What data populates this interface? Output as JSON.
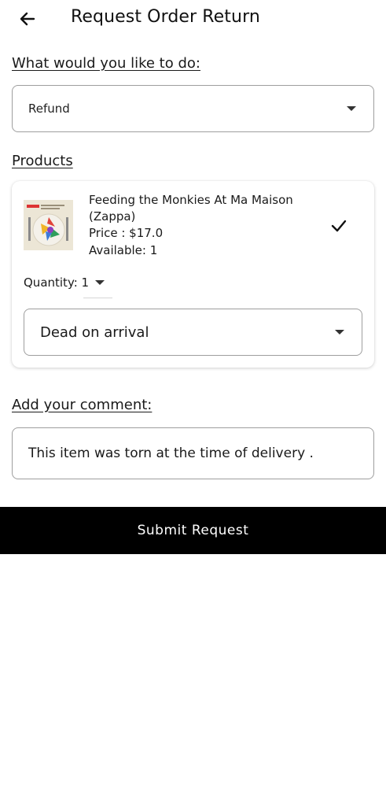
{
  "header": {
    "back_icon": "arrow-left-icon",
    "title": "Request Order Return"
  },
  "action": {
    "label": "What would you like to do:",
    "selected": "Refund"
  },
  "products": {
    "label": "Products",
    "items": [
      {
        "name": "Feeding the Monkies At Ma Maison (Zappa)",
        "price": "Price : $17.0",
        "available": "Available: 1",
        "selected_icon": "check-icon",
        "quantity_label": "Quantity: 1",
        "reason": "Dead on arrival"
      }
    ]
  },
  "comment": {
    "label": "Add your comment:",
    "value": "This item was torn at the time of delivery ."
  },
  "submit": {
    "label": "Submit Request"
  },
  "colors": {
    "primary": "#000000",
    "border": "#9e9e9e",
    "background": "#ffffff"
  }
}
